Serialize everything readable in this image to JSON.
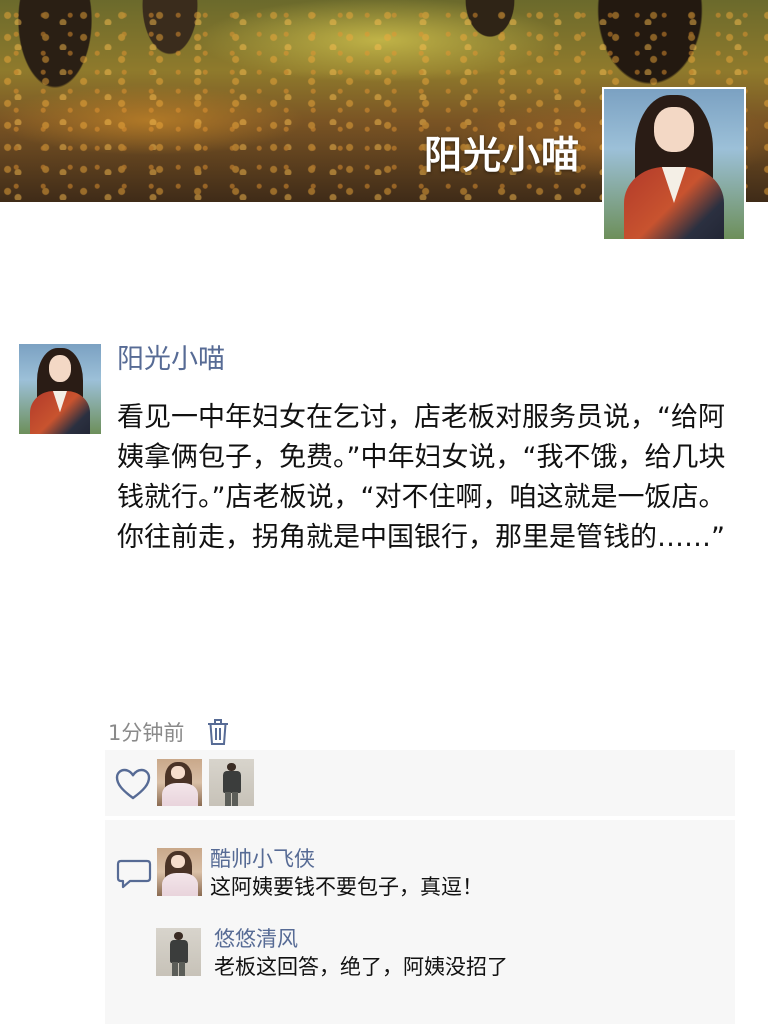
{
  "profile": {
    "name": "阳光小喵"
  },
  "post": {
    "author": "阳光小喵",
    "text": "看见一中年妇女在乞讨，店老板对服务员说，“给阿姨拿俩包子，免费。”中年妇女说，“我不饿，给几块钱就行。”店老板说，“对不住啊，咱这就是一饭店。你往前走，拐角就是中国银行，那里是管钱的……”",
    "time": "1分钟前"
  },
  "likes": {
    "icon": "heart-outline",
    "avatars": [
      "dress-portrait",
      "suit-portrait"
    ]
  },
  "comments": {
    "icon": "comment-bubble",
    "items": [
      {
        "author": "酷帅小飞侠",
        "text": "这阿姨要钱不要包子，真逗！",
        "avatar": "dress-portrait"
      },
      {
        "author": "悠悠清风",
        "text": "老板这回答，绝了，阿姨没招了",
        "avatar": "suit-portrait"
      }
    ]
  },
  "colors": {
    "link": "#576b95",
    "text": "#111111",
    "meta": "#8a8a8a",
    "panel": "#f7f7f7",
    "icon": "#576b95"
  }
}
